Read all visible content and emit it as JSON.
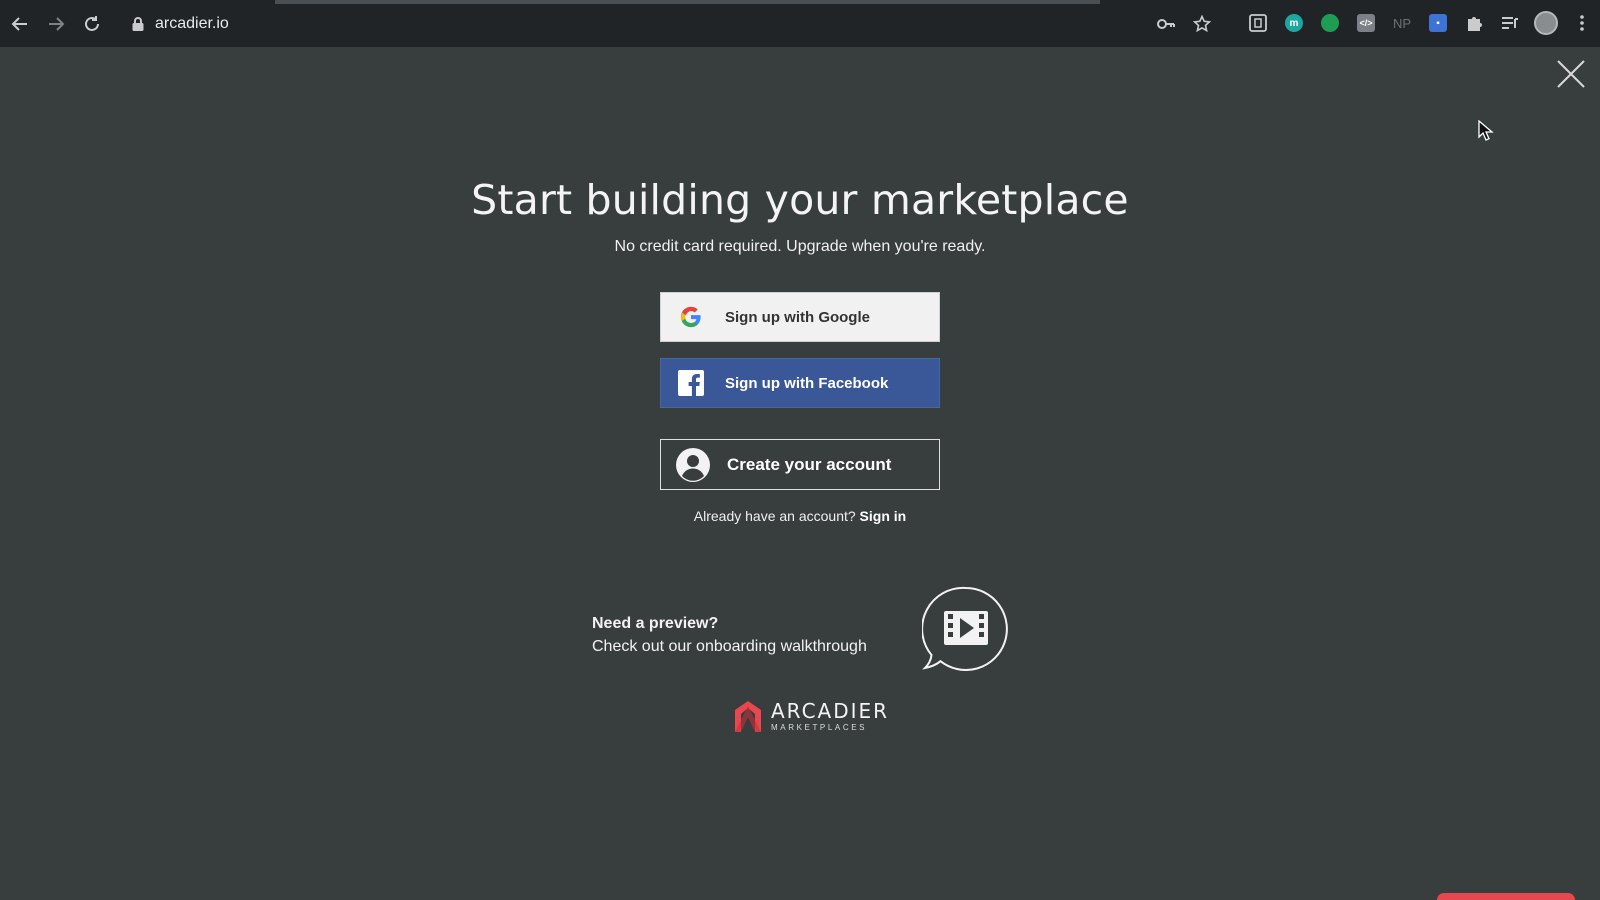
{
  "browser": {
    "url": "arcadier.io",
    "nav": {
      "back_icon": "arrow-left-icon",
      "forward_icon": "arrow-right-icon",
      "reload_icon": "reload-icon"
    },
    "extensions": [
      {
        "name": "reader-extension-icon",
        "color": "#c9cbcd"
      },
      {
        "name": "m-extension-icon",
        "label": "m",
        "color": "#1ea7a0"
      },
      {
        "name": "green-dot-extension-icon",
        "color": "#1f9d55"
      },
      {
        "name": "code-extension-icon",
        "color": "#7c8087"
      },
      {
        "name": "np-extension-icon",
        "label": "NP",
        "color": "#5f6368"
      },
      {
        "name": "blue-box-extension-icon",
        "color": "#3d73d6"
      },
      {
        "name": "puzzle-extensions-icon",
        "color": "#c9cbcd"
      },
      {
        "name": "media-queue-icon",
        "color": "#c9cbcd"
      },
      {
        "name": "profile-avatar",
        "color": "#8a8d90"
      },
      {
        "name": "kebab-menu-icon",
        "color": "#c9cbcd"
      }
    ]
  },
  "page": {
    "title": "Start building your marketplace",
    "subtitle": "No credit card required. Upgrade when you're ready.",
    "google_button": "Sign up with Google",
    "facebook_button": "Sign up with Facebook",
    "create_button": "Create your account",
    "signin_prompt": "Already have an account?",
    "signin_link": "Sign in",
    "preview_title": "Need a preview?",
    "preview_text": "Check out our onboarding walkthrough",
    "logo_name": "ARCADIER",
    "logo_sub": "MARKETPLACES"
  },
  "colors": {
    "background": "#383d3e",
    "facebook": "#3a5898",
    "brand_red": "#e8474f"
  }
}
